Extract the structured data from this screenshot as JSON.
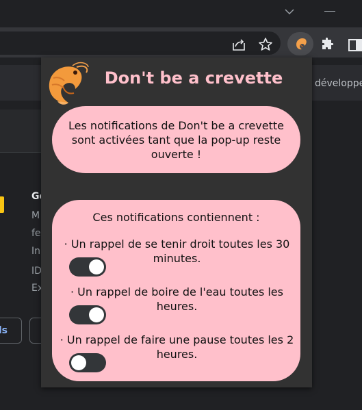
{
  "browser": {
    "extensions_label": "",
    "active_extension": "Don't be a crevette"
  },
  "background_page": {
    "header_text": "développe",
    "card_title": "Go",
    "lines": [
      "M",
      "fe",
      "In",
      "ID",
      "Ex"
    ],
    "left_button_label": "ls"
  },
  "popup": {
    "title": "Don't be a crevette",
    "info_message": "Les notifications de Don't be a crevette sont activées tant que la pop-up reste ouverte !",
    "contents_heading": "Ces notifications contiennent :",
    "reminders": [
      {
        "label": "· Un rappel de se tenir droit toutes les 30 minutes.",
        "enabled": true
      },
      {
        "label": "· Un rappel de boire de l'eau toutes les heures.",
        "enabled": true
      },
      {
        "label": "· Un rappel de faire une pause toutes les 2 heures.",
        "enabled": false
      }
    ]
  },
  "colors": {
    "accent_pink": "#ffc0cb",
    "popup_background": "#323232",
    "toggle_track": "#333639"
  }
}
